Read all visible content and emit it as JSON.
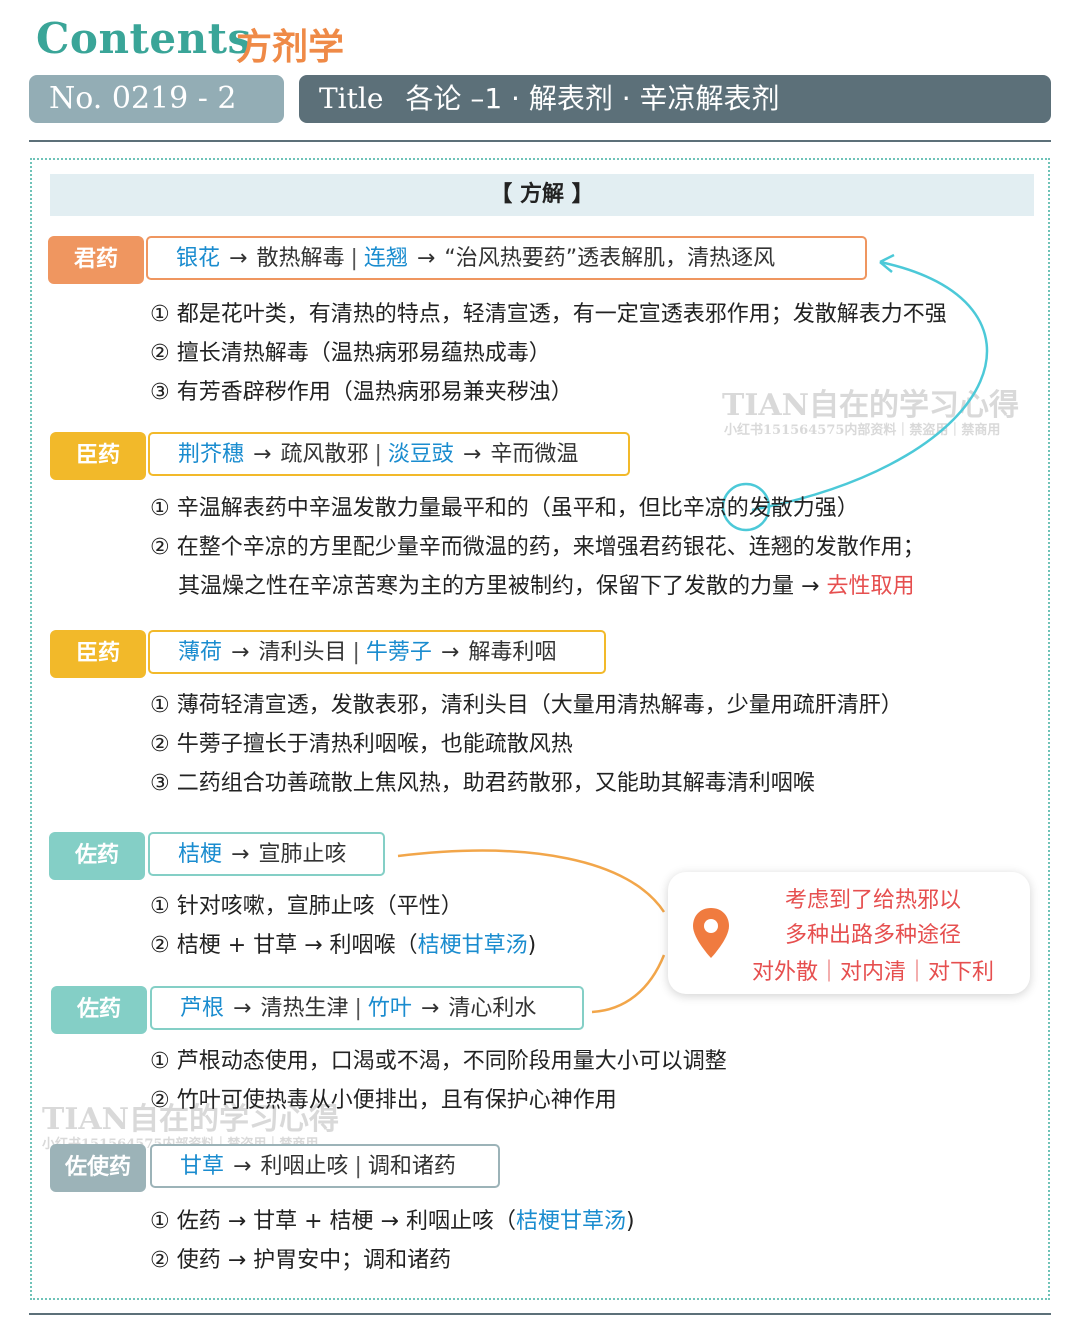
{
  "header": {
    "contents_label": "Contents",
    "subject": "方剂学",
    "number": "No. 0219 - 2",
    "title_label": "Title",
    "title_text": "各论 –1 · 解表剂 · 辛凉解表剂"
  },
  "section_title": "【 方解 】",
  "groups": [
    {
      "tag": "君药",
      "box": {
        "herb1": "银花",
        "effect1": "散热解毒",
        "herb2": "连翘",
        "effect2": "“治风热要药”透表解肌，清热逐风"
      },
      "notes": [
        "① 都是花叶类，有清热的特点，轻清宣透，有一定宣透表邪作用；发散解表力不强",
        "② 擅长清热解毒（温热病邪易蕴热成毒）",
        "③ 有芳香辟秽作用（温热病邪易兼夹秽浊）"
      ]
    },
    {
      "tag": "臣药",
      "box": {
        "herb1": "荆芥穗",
        "effect1": "疏风散邪",
        "herb2": "淡豆豉",
        "effect2": "辛而微温"
      },
      "notes": [
        "① 辛温解表药中辛温发散力量最平和的（虽平和，但比辛凉的发散力强）",
        "② 在整个辛凉的方里配少量辛而微温的药，来增强君药银花、连翘的发散作用；",
        "其温燥之性在辛凉苦寒为主的方里被制约，保留下了发散的力量 →"
      ],
      "highlight": "去性取用"
    },
    {
      "tag": "臣药",
      "box": {
        "herb1": "薄荷",
        "effect1": "清利头目",
        "herb2": "牛蒡子",
        "effect2": "解毒利咽"
      },
      "notes": [
        "① 薄荷轻清宣透，发散表邪，清利头目（大量用清热解毒，少量用疏肝清肝）",
        "② 牛蒡子擅长于清热利咽喉，也能疏散风热",
        "③ 二药组合功善疏散上焦风热，助君药散邪，又能助其解毒清利咽喉"
      ]
    },
    {
      "tag": "佐药",
      "box": {
        "herb1": "桔梗",
        "effect1": "宣肺止咳"
      },
      "notes": [
        "① 针对咳嗽，宣肺止咳（平性）",
        "② 桔梗 + 甘草 → 利咽喉（",
        ")"
      ],
      "formula": "桔梗甘草汤"
    },
    {
      "tag": "佐药",
      "box": {
        "herb1": "芦根",
        "effect1": "清热生津",
        "herb2": "竹叶",
        "effect2": "清心利水"
      },
      "notes": [
        "① 芦根动态使用，口渴或不渴，不同阶段用量大小可以调整",
        "② 竹叶可使热毒从小便排出，且有保护心神作用"
      ]
    },
    {
      "tag": "佐使药",
      "box": {
        "herb1": "甘草",
        "effect1": "利咽止咳",
        "effect2": "调和诸药"
      },
      "notes": [
        "① 佐药 → 甘草 + 桔梗 → 利咽止咳（",
        ")",
        "② 使药 → 护胃安中；调和诸药"
      ],
      "formula": "桔梗甘草汤"
    }
  ],
  "callout": {
    "line1": "考虑到了给热邪以",
    "line2": "多种出路多种途径",
    "line3": "对外散｜对内清｜对下利",
    "icon": "location-pin-icon"
  },
  "watermark": {
    "title": "TIAN自在的学习心得",
    "subtitle": "小红书151564575内部资料｜禁盗用｜禁商用"
  },
  "colors": {
    "teal": "#3aa598",
    "orange": "#ef8a47",
    "tag_orange": "#ef9660",
    "tag_yellow": "#f2b92a",
    "tag_teal": "#84cfc6",
    "tag_gray": "#9cb3b8",
    "herb_blue": "#1a8ccf",
    "red": "#e64f4f",
    "title_bar": "#5c7079",
    "no_bar": "#93adb5"
  }
}
